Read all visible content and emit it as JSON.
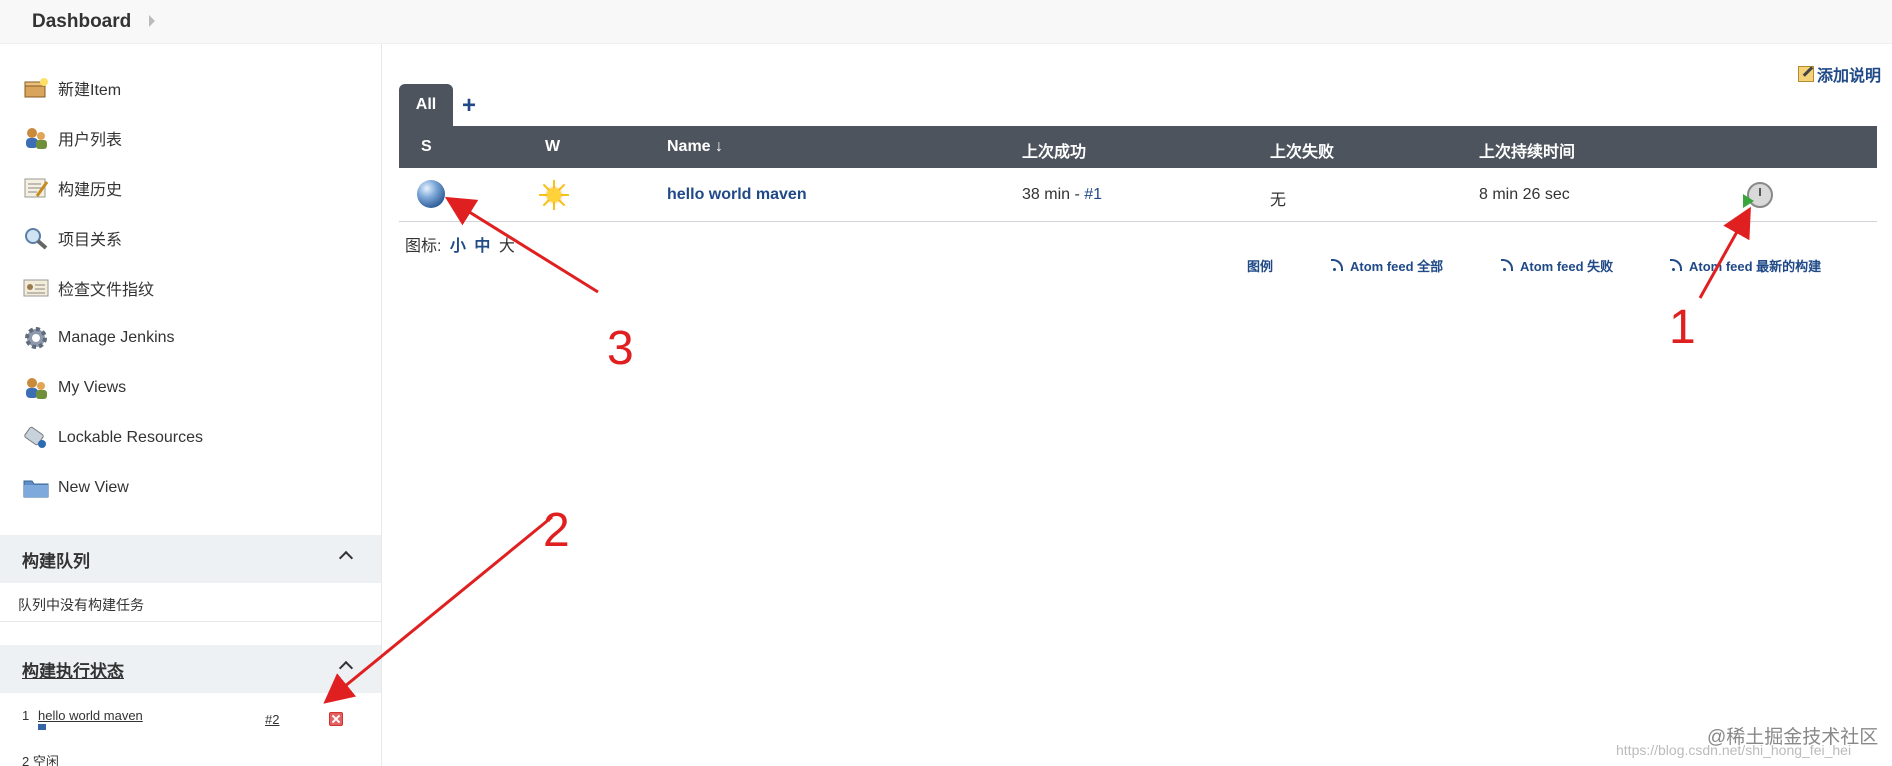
{
  "header": {
    "breadcrumb": "Dashboard"
  },
  "sidebar": {
    "items": [
      {
        "label": "新建Item",
        "icon": "new-item-icon"
      },
      {
        "label": "用户列表",
        "icon": "users-icon"
      },
      {
        "label": "构建历史",
        "icon": "build-history-icon"
      },
      {
        "label": "项目关系",
        "icon": "search-icon"
      },
      {
        "label": "检查文件指纹",
        "icon": "fingerprint-icon"
      },
      {
        "label": "Manage Jenkins",
        "icon": "gear-icon"
      },
      {
        "label": "My Views",
        "icon": "users-icon"
      },
      {
        "label": "Lockable Resources",
        "icon": "lock-icon"
      },
      {
        "label": "New View",
        "icon": "folder-icon"
      }
    ],
    "build_queue": {
      "title": "构建队列",
      "empty_text": "队列中没有构建任务"
    },
    "executor_status": {
      "title": "构建执行状态",
      "rows": [
        {
          "num": "1",
          "job": "hello world maven",
          "build": "#2"
        },
        {
          "num": "2",
          "status": "空闲"
        }
      ]
    }
  },
  "main": {
    "add_description": "添加说明",
    "tabs": [
      {
        "label": "All",
        "active": true
      }
    ],
    "add_tab": "+",
    "columns": [
      "S",
      "W",
      "Name ↓",
      "上次成功",
      "上次失败",
      "上次持续时间"
    ],
    "jobs": [
      {
        "status_color": "blue",
        "weather": "sunny",
        "name": "hello world maven",
        "last_success": "38 min - ",
        "last_success_build": "#1",
        "last_failure": "无",
        "last_duration": "8 min 26 sec"
      }
    ],
    "icon_size": {
      "label": "图标:",
      "small": "小",
      "medium": "中",
      "large": "大"
    },
    "footer_links": {
      "legend": "图例",
      "atom_all": "Atom feed 全部",
      "atom_failed": "Atom feed 失败",
      "atom_latest": "Atom feed 最新的构建"
    }
  },
  "annotations": {
    "one": "1",
    "two": "2",
    "three": "3",
    "color": "#e02020"
  },
  "watermark": {
    "text": "@稀土掘金技术社区",
    "url": "https://blog.csdn.net/shi_hong_fei_hei"
  }
}
